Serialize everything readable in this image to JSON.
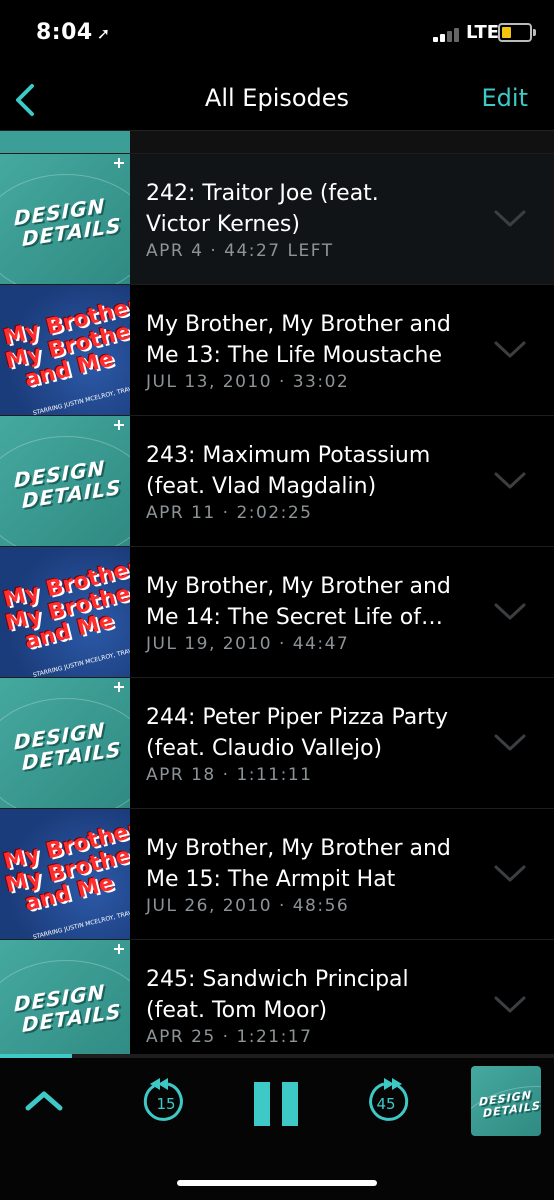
{
  "status": {
    "time": "8:04",
    "network": "LTE",
    "battery_level": 0.35,
    "accent_battery": "#f1c40f"
  },
  "nav": {
    "title": "All Episodes",
    "edit_label": "Edit"
  },
  "accent": "#3ec9c7",
  "art_text": {
    "design_details": [
      "DESIGN",
      "DETAILS"
    ],
    "mbmbam": [
      "My Brother,",
      "My Brother",
      "and Me"
    ],
    "mbmbam_starring": "STARRING JUSTIN MCELROY, TRAVIS MCELROY and GRIFFIN MCELROY"
  },
  "episodes": [
    {
      "show": "design-details",
      "line1": "242: Traitor Joe (feat.",
      "line2": "Victor Kernes)",
      "meta": "APR 4 · 44:27 LEFT",
      "active": true
    },
    {
      "show": "mbmbam",
      "line1": "My Brother, My Brother and",
      "line2": "Me 13: The Life Moustache",
      "meta": "JUL 13, 2010 · 33:02",
      "active": false
    },
    {
      "show": "design-details",
      "line1": "243: Maximum Potassium",
      "line2": "(feat. Vlad Magdalin)",
      "meta": "APR 11 · 2:02:25",
      "active": false
    },
    {
      "show": "mbmbam",
      "line1": "My Brother, My Brother and",
      "line2": "Me 14: The Secret Life of…",
      "meta": "JUL 19, 2010 · 44:47",
      "active": false
    },
    {
      "show": "design-details",
      "line1": "244: Peter Piper Pizza Party",
      "line2": "(feat. Claudio Vallejo)",
      "meta": "APR 18 · 1:11:11",
      "active": false
    },
    {
      "show": "mbmbam",
      "line1": "My Brother, My Brother and",
      "line2": "Me 15: The Armpit Hat",
      "meta": "JUL 26, 2010 · 48:56",
      "active": false
    },
    {
      "show": "design-details",
      "line1": "245: Sandwich Principal",
      "line2": "(feat. Tom Moor)",
      "meta": "APR 25 · 1:21:17",
      "active": false
    }
  ],
  "player": {
    "rewind_seconds": "15",
    "forward_seconds": "45",
    "progress": 0.13,
    "mini_art_text": [
      "DESIGN",
      "DETAILS"
    ]
  }
}
